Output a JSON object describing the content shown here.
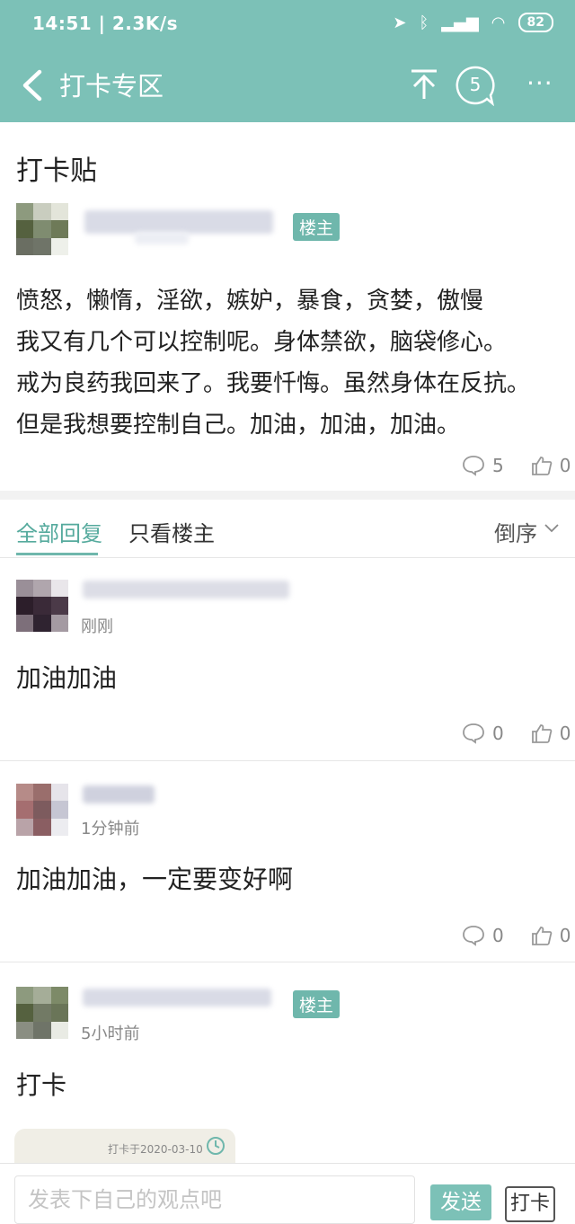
{
  "status_bar": {
    "time": "14:51 | 2.3K/s",
    "battery": "82",
    "colors": {
      "bar": "#7cc1b7"
    }
  },
  "app_bar": {
    "title": "打卡专区",
    "comment_count": "5",
    "more": "···"
  },
  "post": {
    "title": "打卡贴",
    "op_badge": "楼主",
    "body_lines": [
      "愤怒，懒惰，淫欲，嫉妒，暴食，贪婪，傲慢",
      "我又有几个可以控制呢。身体禁欲，脑袋修心。",
      "戒为良药我回来了。我要忏悔。虽然身体在反抗。",
      "但是我想要控制自己。加油，加油，加油。"
    ],
    "comments": "5",
    "likes": "0"
  },
  "tabs": {
    "all": "全部回复",
    "op_only": "只看楼主",
    "sort": "倒序"
  },
  "replies": [
    {
      "time": "刚刚",
      "text": "加油加油",
      "comments": "0",
      "likes": "0",
      "is_op": false
    },
    {
      "time": "1分钟前",
      "text": "加油加油，一定要变好啊",
      "comments": "0",
      "likes": "0",
      "is_op": false
    },
    {
      "time": "5小时前",
      "text": "打卡",
      "is_op": true,
      "badge": "楼主",
      "checkin": "打卡于2020-03-10"
    }
  ],
  "bottom_bar": {
    "placeholder": "发表下自己的观点吧",
    "send": "发送",
    "checkin": "打卡"
  },
  "accent_color": "#6fb7ac"
}
